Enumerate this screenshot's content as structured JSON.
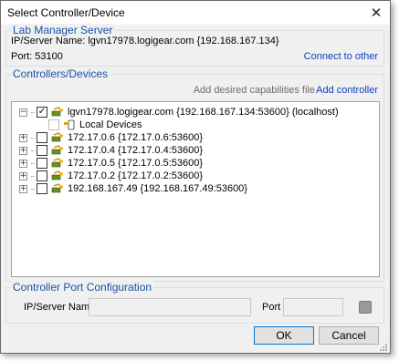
{
  "window": {
    "title": "Select Controller/Device",
    "close_glyph": "✕"
  },
  "lab_manager": {
    "legend": "Lab Manager Server",
    "ip_line": "IP/Server Name: lgvn17978.logigear.com {192.168.167.134}",
    "port_line": "Port: 53100",
    "connect_link": "Connect to other"
  },
  "controllers": {
    "legend": "Controllers/Devices",
    "add_capabilities": "Add desired capabilities file",
    "add_controller": "Add controller",
    "tree": [
      {
        "label": "lgvn17978.logigear.com {192.168.167.134:53600} (localhost)",
        "expanded": true,
        "checked": true,
        "icon": "controller-icon"
      },
      {
        "label": "Local Devices",
        "child": true,
        "checked": false,
        "icon": "local-device-icon"
      },
      {
        "label": "172.17.0.6 {172.17.0.6:53600}",
        "expanded": false,
        "checked": false,
        "icon": "controller-icon"
      },
      {
        "label": "172.17.0.4 {172.17.0.4:53600}",
        "expanded": false,
        "checked": false,
        "icon": "controller-icon"
      },
      {
        "label": "172.17.0.5 {172.17.0.5:53600}",
        "expanded": false,
        "checked": false,
        "icon": "controller-icon"
      },
      {
        "label": "172.17.0.2 {172.17.0.2:53600}",
        "expanded": false,
        "checked": false,
        "icon": "controller-icon"
      },
      {
        "label": "192.168.167.49 {192.168.167.49:53600}",
        "expanded": false,
        "checked": false,
        "icon": "controller-icon"
      }
    ]
  },
  "port_config": {
    "legend": "Controller Port Configuration",
    "ip_label": "IP/Server Name",
    "ip_value": "",
    "port_label": "Port",
    "port_value": ""
  },
  "buttons": {
    "ok": "OK",
    "cancel": "Cancel"
  },
  "colors": {
    "legend": "#1a52a6",
    "link": "#0b3fbf",
    "muted_text": "#6d6d6d"
  }
}
